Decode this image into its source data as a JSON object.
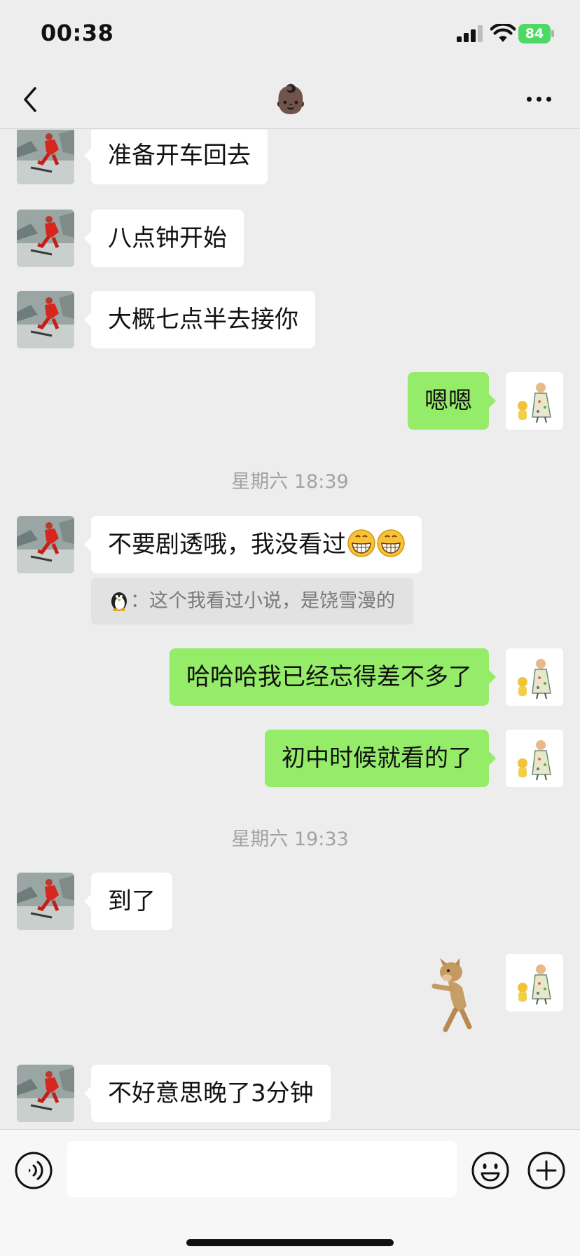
{
  "status_bar": {
    "time": "00:38",
    "battery": "84"
  },
  "nav": {
    "title_emoji": "👶🏿"
  },
  "messages": [
    {
      "from": "them",
      "text": "准备开车回去"
    },
    {
      "from": "them",
      "text": "八点钟开始"
    },
    {
      "from": "them",
      "text": "大概七点半去接你"
    },
    {
      "from": "me",
      "text": "嗯嗯"
    },
    {
      "timestamp": "星期六 18:39"
    },
    {
      "from": "them",
      "text": "不要剧透哦，我没看过",
      "quote": "：这个我看过小说，是饶雪漫的"
    },
    {
      "from": "me",
      "text": "哈哈哈我已经忘得差不多了"
    },
    {
      "from": "me",
      "text": "初中时候就看的了"
    },
    {
      "timestamp": "星期六 19:33"
    },
    {
      "from": "them",
      "text": "到了"
    },
    {
      "from": "me",
      "sticker": "dancing-dog-sticker"
    },
    {
      "from": "them",
      "text": "不好意思晚了3分钟"
    }
  ],
  "input": {
    "placeholder": ""
  },
  "colors": {
    "background": "#ededed",
    "my_bubble": "#95ec69",
    "their_bubble": "#ffffff"
  }
}
